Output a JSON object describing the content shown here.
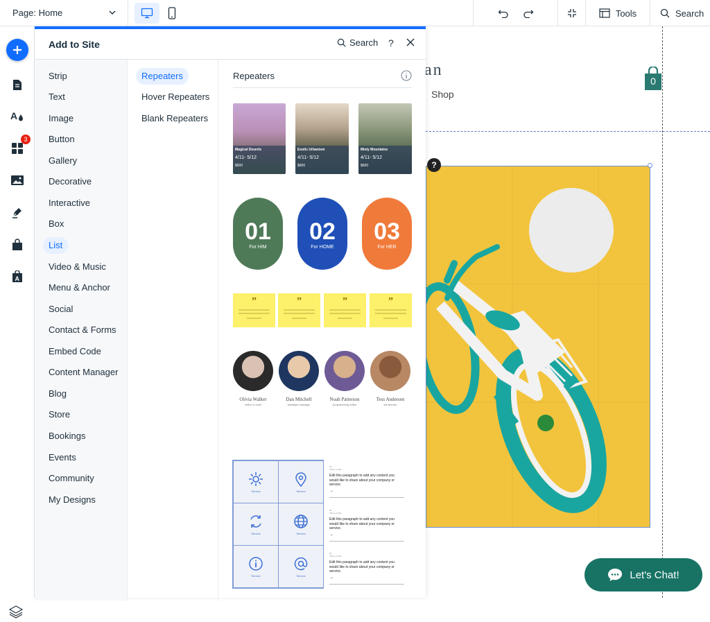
{
  "topbar": {
    "page_select": "Page: Home",
    "tools_label": "Tools",
    "search_label": "Search"
  },
  "left_rail": {
    "apps_badge": "3"
  },
  "panel": {
    "title": "Add to Site",
    "search_label": "Search",
    "help": "?",
    "categories": [
      "Strip",
      "Text",
      "Image",
      "Button",
      "Gallery",
      "Decorative",
      "Interactive",
      "Box",
      "List",
      "Video & Music",
      "Menu & Anchor",
      "Social",
      "Contact & Forms",
      "Embed Code",
      "Content Manager",
      "Blog",
      "Store",
      "Bookings",
      "Events",
      "Community",
      "My Designs"
    ],
    "active_category": "List",
    "subcategories": [
      "Repeaters",
      "Hover Repeaters",
      "Blank Repeaters"
    ],
    "active_subcategory": "Repeaters",
    "section_title": "Repeaters",
    "travel_cards": [
      {
        "title": "Magical Deserts",
        "dates": "4/11- 5/12",
        "price": "$600"
      },
      {
        "title": "Exotic Urbanism",
        "dates": "4/11- 5/12",
        "price": "$600"
      },
      {
        "title": "Misty Mountains",
        "dates": "4/11- 5/12",
        "price": "$600"
      }
    ],
    "pill_cards": [
      {
        "num": "01",
        "label": "For HIM"
      },
      {
        "num": "02",
        "label": "For HOME"
      },
      {
        "num": "03",
        "label": "For HER"
      }
    ],
    "quote_mark": "”",
    "people": [
      {
        "name": "Olivia Walker",
        "role": "editor in chief"
      },
      {
        "name": "Dan Mitchell",
        "role": "assistant manager"
      },
      {
        "name": "Noah Patterson",
        "role": "programming editor"
      },
      {
        "name": "Tess Andersen",
        "role": "art director"
      }
    ],
    "service_label": "Service",
    "service_items": [
      {
        "num": "01.",
        "title": "This is a Title",
        "body": "Edit this paragraph to add any content you would like to share about your company or service."
      },
      {
        "num": "02.",
        "title": "This is a Title",
        "body": "Edit this paragraph to add any content you would like to share about your company or service."
      },
      {
        "num": "03.",
        "title": "This is a Title",
        "body": "Edit this paragraph to add any content you would like to share about your company or service."
      }
    ]
  },
  "site": {
    "logo_fragment": "an",
    "nav_shop": "Shop",
    "cart_count": "0",
    "help_mark": "?",
    "chat_label": "Let's Chat!"
  },
  "colors": {
    "accent": "#116dff",
    "hero_yellow": "#f2c43d",
    "chat_green": "#187365",
    "bike_teal": "#1aa6a0"
  }
}
